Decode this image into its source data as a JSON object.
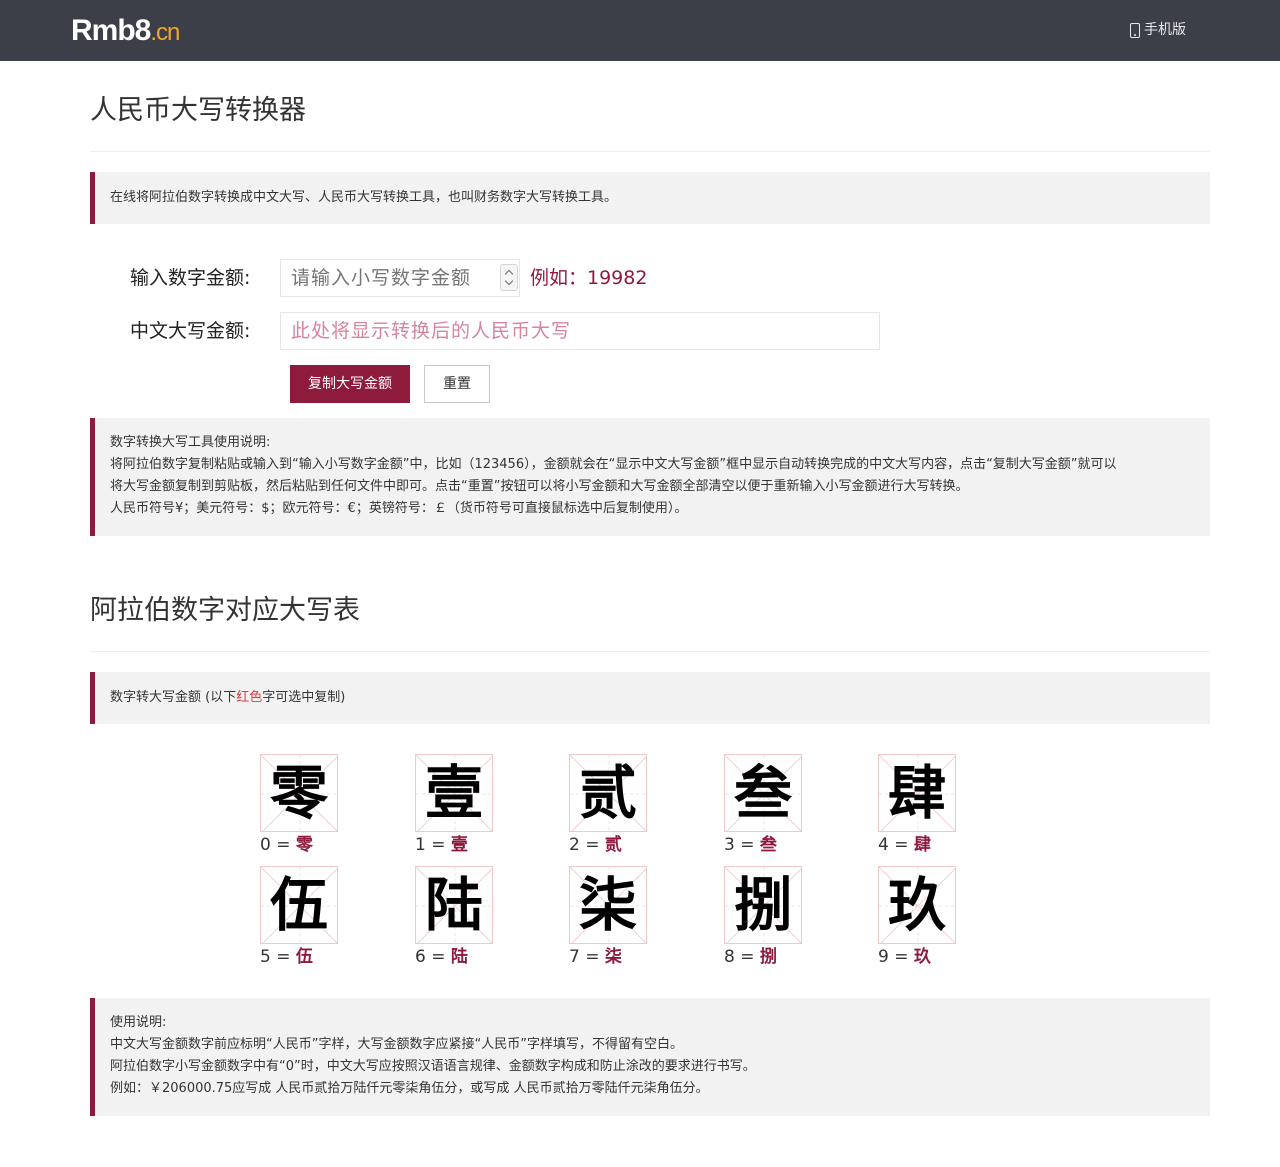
{
  "header": {
    "logo_main": "Rmb8",
    "logo_suffix": ".cn",
    "mobile_link": "手机版",
    "colors": {
      "bar": "#3c3e48",
      "accent": "#8e1a3c"
    }
  },
  "converter": {
    "title": "人民币大写转换器",
    "intro": "在线将阿拉伯数字转换成中文大写、人民币大写转换工具，也叫财务数字大写转换工具。",
    "input_label": "输入数字金额:",
    "input_placeholder": "请输入小写数字金额",
    "example": "例如：19982",
    "output_label": "中文大写金额:",
    "output_placeholder": "此处将显示转换后的人民币大写",
    "copy_button": "复制大写金额",
    "reset_button": "重置",
    "help": [
      "数字转换大写工具使用说明:",
      "将阿拉伯数字复制粘贴或输入到“输入小写数字金额”中，比如（123456），金额就会在“显示中文大写金额”框中显示自动转换完成的中文大写内容，点击“复制大写金额”就可以",
      "将大写金额复制到剪贴板，然后粘贴到任何文件中即可。点击“重置”按钮可以将小写金额和大写金额全部清空以便于重新输入小写金额进行大写转换。",
      "人民币符号¥；美元符号：$；欧元符号：€；英镑符号：￡（货币符号可直接鼠标选中后复制使用）。"
    ]
  },
  "table": {
    "title": "阿拉伯数字对应大写表",
    "note_prefix": "数字转大写金额 (以下",
    "note_red": "红色",
    "note_suffix": "字可选中复制)",
    "digits": [
      {
        "num": "0",
        "eq": " = ",
        "char": "零"
      },
      {
        "num": "1",
        "eq": " = ",
        "char": "壹"
      },
      {
        "num": "2",
        "eq": " = ",
        "char": "贰"
      },
      {
        "num": "3",
        "eq": " = ",
        "char": "叁"
      },
      {
        "num": "4",
        "eq": " = ",
        "char": "肆"
      },
      {
        "num": "5",
        "eq": " = ",
        "char": "伍"
      },
      {
        "num": "6",
        "eq": " = ",
        "char": "陆"
      },
      {
        "num": "7",
        "eq": " = ",
        "char": "柒"
      },
      {
        "num": "8",
        "eq": " = ",
        "char": "捌"
      },
      {
        "num": "9",
        "eq": " = ",
        "char": "玖"
      }
    ]
  },
  "usage": [
    "使用说明:",
    "中文大写金额数字前应标明“人民币”字样，大写金额数字应紧接“人民币”字样填写，不得留有空白。",
    "阿拉伯数字小写金额数字中有“0”时，中文大写应按照汉语语言规律、金额数字构成和防止涂改的要求进行书写。",
    "例如：￥206000.75应写成 人民币贰拾万陆仟元零柒角伍分，或写成 人民币贰拾万零陆仟元柒角伍分。"
  ]
}
